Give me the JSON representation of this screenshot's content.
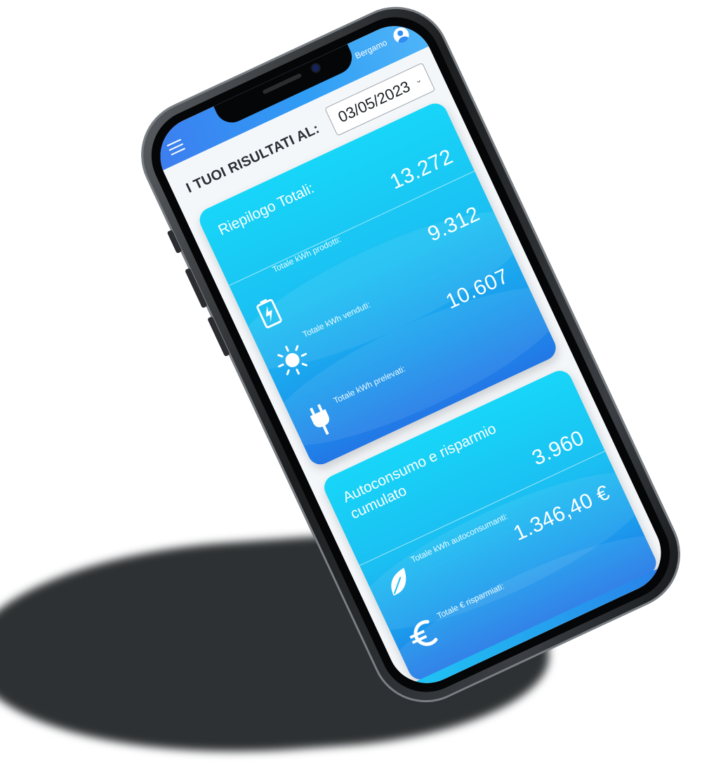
{
  "header": {
    "location": "Bergamo",
    "menu_icon": "hamburger-menu-icon",
    "user_icon": "user-account-icon"
  },
  "results": {
    "label": "I TUOI RISULTATI AL:",
    "date": "03/05/2023"
  },
  "summary_card": {
    "title": "Riepilogo Totali:",
    "items": [
      {
        "value": "13.272",
        "label": "Totale kWh prodotti:",
        "icon": "battery-charging-icon"
      },
      {
        "value": "9.312",
        "label": "Totale kWh venduti:",
        "icon": "sun-icon"
      },
      {
        "value": "10.607",
        "label": "Totale kWh prelevati:",
        "icon": "power-plug-icon"
      }
    ]
  },
  "savings_card": {
    "title": "Autoconsumo e risparmio cumulato",
    "items": [
      {
        "value": "3.960",
        "label": "Totale kWh autoconsumanti:",
        "icon": "leaf-icon"
      },
      {
        "value": "1.346,40 €",
        "label": "Totale € risparmiati:",
        "icon": "euro-icon"
      }
    ]
  },
  "colors": {
    "accent_top": "#2f9df5",
    "card_light": "#17d6f8",
    "card_dark": "#2277e6",
    "phone_frame": "#1c1e20",
    "shadow": "#2e3133"
  }
}
